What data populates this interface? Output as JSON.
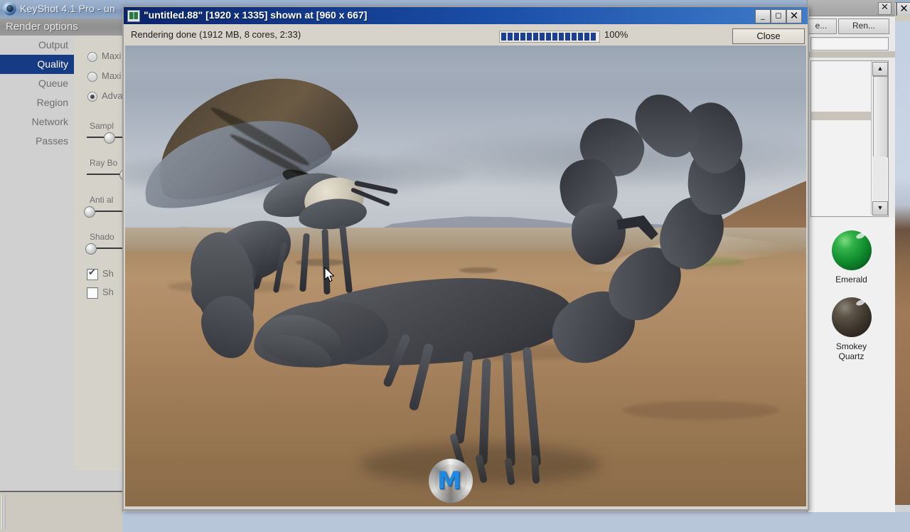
{
  "app": {
    "title": "KeyShot 4.1 Pro  - un",
    "logo_icon": "keyshot-logo-icon"
  },
  "render_options": {
    "header": "Render options",
    "items": [
      {
        "label": "Output",
        "selected": false
      },
      {
        "label": "Quality",
        "selected": true
      },
      {
        "label": "Queue",
        "selected": false
      },
      {
        "label": "Region",
        "selected": false
      },
      {
        "label": "Network",
        "selected": false
      },
      {
        "label": "Passes",
        "selected": false
      }
    ],
    "radios": [
      {
        "label": "Maxi",
        "selected": false
      },
      {
        "label": "Maxi",
        "selected": false
      },
      {
        "label": "Adva",
        "selected": true
      }
    ],
    "sliders": [
      {
        "label": "Sampl",
        "value": 52
      },
      {
        "label": "Ray Bo",
        "value": 92
      },
      {
        "label": "Anti al",
        "value": 6
      },
      {
        "label": "Shado",
        "value": 10
      }
    ],
    "checkboxes": [
      {
        "label": "Sh",
        "checked": true
      },
      {
        "label": "Sh",
        "checked": false
      }
    ]
  },
  "render_window": {
    "title": "\"untitled.88\" [1920 x 1335] shown at [960 x 667]",
    "icon": "image-window-icon",
    "status": "Rendering done (1912 MB, 8 cores,  2:33)",
    "progress_percent": "100%",
    "progress_value": 100,
    "close_button": "Close",
    "minimize_icon": "minimize-icon",
    "maximize_icon": "maximize-icon",
    "close_icon": "close-icon"
  },
  "right_panel": {
    "close_icon": "close-icon",
    "buttons": [
      {
        "label": "e..."
      },
      {
        "label": "Ren..."
      }
    ],
    "search_value": "",
    "scroll_up_icon": "triangle-up-icon",
    "scroll_down_icon": "triangle-down-icon",
    "materials": [
      {
        "name": "Emerald",
        "color": "#0f8a2c"
      },
      {
        "name": "Smokey\nQuartz",
        "line1": "Smokey",
        "line2": "Quartz",
        "color": "#3b342b"
      }
    ]
  },
  "background_window": {
    "maximize_icon": "maximize-icon",
    "close_icon": "close-icon"
  },
  "scene": {
    "description": "3D rendered scorpion and winged insect in a desert landscape",
    "watermark_letter": "M",
    "cursor_icon": "mouse-pointer-icon"
  },
  "colors": {
    "titlebar_start": "#0a246a",
    "titlebar_end": "#3f7cc9",
    "selection": "#173a84",
    "progress": "#1b3f93",
    "emerald": "#0f8a2c",
    "smokey_quartz": "#3b342b"
  }
}
